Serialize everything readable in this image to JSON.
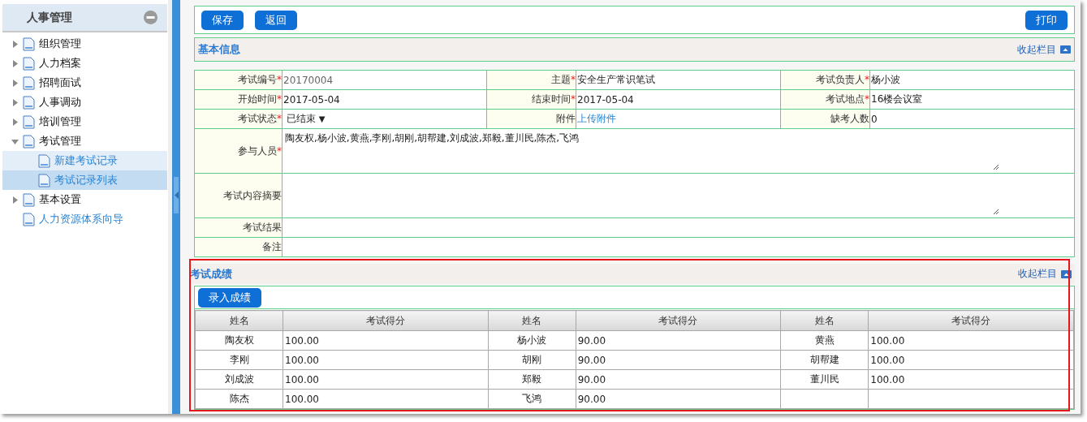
{
  "sidebar": {
    "title": "人事管理",
    "items": [
      {
        "label": "组织管理",
        "kind": "folder",
        "expanded": false
      },
      {
        "label": "人力档案",
        "kind": "folder",
        "expanded": false
      },
      {
        "label": "招聘面试",
        "kind": "folder",
        "expanded": false
      },
      {
        "label": "人事调动",
        "kind": "folder",
        "expanded": false
      },
      {
        "label": "培训管理",
        "kind": "folder",
        "expanded": false
      },
      {
        "label": "考试管理",
        "kind": "folder",
        "expanded": true,
        "children": [
          {
            "label": "新建考试记录",
            "selected": false
          },
          {
            "label": "考试记录列表",
            "selected": true
          }
        ]
      },
      {
        "label": "基本设置",
        "kind": "folder",
        "expanded": false
      },
      {
        "label": "人力资源体系向导",
        "kind": "link"
      }
    ]
  },
  "toolbar": {
    "buttons": [
      "保存",
      "返回"
    ],
    "print_button": "打印"
  },
  "basic_info": {
    "title": "基本信息",
    "collapse_link": "收起栏目",
    "required_mark": "*",
    "rows": [
      [
        {
          "label": "考试编号",
          "required": true,
          "kind": "readonly",
          "value": "20170004"
        },
        {
          "label": "主题",
          "required": true,
          "kind": "text",
          "value": "安全生产常识笔试"
        },
        {
          "label": "考试负责人",
          "required": true,
          "kind": "text",
          "value": "杨小波"
        }
      ],
      [
        {
          "label": "开始时间",
          "required": true,
          "kind": "text",
          "value": "2017-05-04"
        },
        {
          "label": "结束时间",
          "required": true,
          "kind": "text",
          "value": "2017-05-04"
        },
        {
          "label": "考试地点",
          "required": true,
          "kind": "text",
          "value": "16楼会议室"
        }
      ],
      [
        {
          "label": "考试状态",
          "required": true,
          "kind": "select",
          "value": "已结束",
          "caret": "▼"
        },
        {
          "label": "附件",
          "required": false,
          "kind": "link",
          "value": "上传附件"
        },
        {
          "label": "缺考人数",
          "required": false,
          "kind": "text",
          "value": "0"
        }
      ],
      [
        {
          "label": "参与人员",
          "required": true,
          "kind": "textarea",
          "value": "陶友权,杨小波,黄燕,李刚,胡刚,胡帮建,刘成波,郑毅,董川民,陈杰,飞鸿"
        }
      ],
      [
        {
          "label": "考试内容摘要",
          "required": false,
          "kind": "textarea"
        }
      ],
      [
        {
          "label": "考试结果",
          "required": false,
          "kind": "text"
        }
      ],
      [
        {
          "label": "备注",
          "required": false,
          "kind": "text"
        }
      ]
    ]
  },
  "scores": {
    "title": "考试成绩",
    "collapse_link": "收起栏目",
    "add_button": "录入成绩",
    "columns": [
      "姓名",
      "考试得分",
      "姓名",
      "考试得分",
      "姓名",
      "考试得分"
    ],
    "rows": [
      [
        "陶友权",
        "100.00",
        "杨小波",
        "90.00",
        "黄燕",
        "100.00"
      ],
      [
        "李刚",
        "100.00",
        "胡刚",
        "90.00",
        "胡帮建",
        "100.00"
      ],
      [
        "刘成波",
        "100.00",
        "郑毅",
        "90.00",
        "董川民",
        "100.00"
      ],
      [
        "陈杰",
        "100.00",
        "飞鸿",
        "90.00"
      ]
    ]
  }
}
